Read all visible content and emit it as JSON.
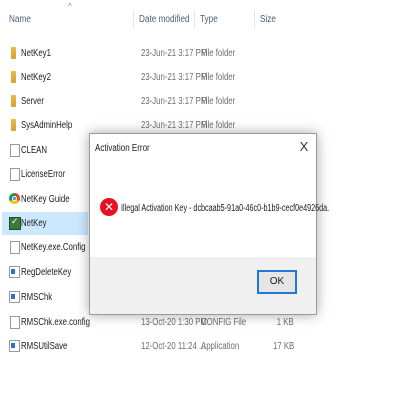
{
  "columns": {
    "name": "Name",
    "date": "Date modified",
    "type": "Type",
    "size": "Size"
  },
  "files": [
    {
      "icon": "folder-icon",
      "name": "NetKey1",
      "date": "23-Jun-21 3:17 PM",
      "type": "File folder",
      "size": ""
    },
    {
      "icon": "folder-icon",
      "name": "NetKey2",
      "date": "23-Jun-21 3:17 PM",
      "type": "File folder",
      "size": ""
    },
    {
      "icon": "folder-icon",
      "name": "Server",
      "date": "23-Jun-21 3:17 PM",
      "type": "File folder",
      "size": ""
    },
    {
      "icon": "folder-icon",
      "name": "SysAdminHelp",
      "date": "23-Jun-21 3:17 PM",
      "type": "File folder",
      "size": ""
    },
    {
      "icon": "document-icon",
      "name": "CLEAN",
      "date": "",
      "type": "",
      "size": ""
    },
    {
      "icon": "document-icon",
      "name": "LicenseError",
      "date": "",
      "type": "",
      "size": ""
    },
    {
      "icon": "chrome-icon",
      "name": "NetKey Guide",
      "date": "",
      "type": "",
      "size": ""
    },
    {
      "icon": "netkey-app-icon",
      "name": "NetKey",
      "date": "",
      "type": "",
      "size": ""
    },
    {
      "icon": "document-icon",
      "name": "NetKey.exe.Config",
      "date": "",
      "type": "",
      "size": ""
    },
    {
      "icon": "application-icon",
      "name": "RegDeleteKey",
      "date": "",
      "type": "",
      "size": ""
    },
    {
      "icon": "application-icon",
      "name": "RMSChk",
      "date": "",
      "type": "",
      "size": ""
    },
    {
      "icon": "document-icon",
      "name": "RMSChk.exe.config",
      "date": "13-Oct-20 1:30 PM",
      "type": "CONFIG File",
      "size": "1 KB"
    },
    {
      "icon": "application-icon",
      "name": "RMSUtilSave",
      "date": "12-Oct-20 11:24 ...",
      "type": "Application",
      "size": "17 KB"
    }
  ],
  "dialog": {
    "title": "Activation Error",
    "close_label": "X",
    "message": "Illegal Activation Key - dcbcaab5-91a0-46c0-b1b9-cecf0e4926da.",
    "error_glyph": "✕",
    "ok_label": "OK"
  },
  "colors": {
    "selection": "#cce8ff",
    "error": "#e81123",
    "accent": "#2378d4",
    "folder": "#e2ad3c"
  }
}
